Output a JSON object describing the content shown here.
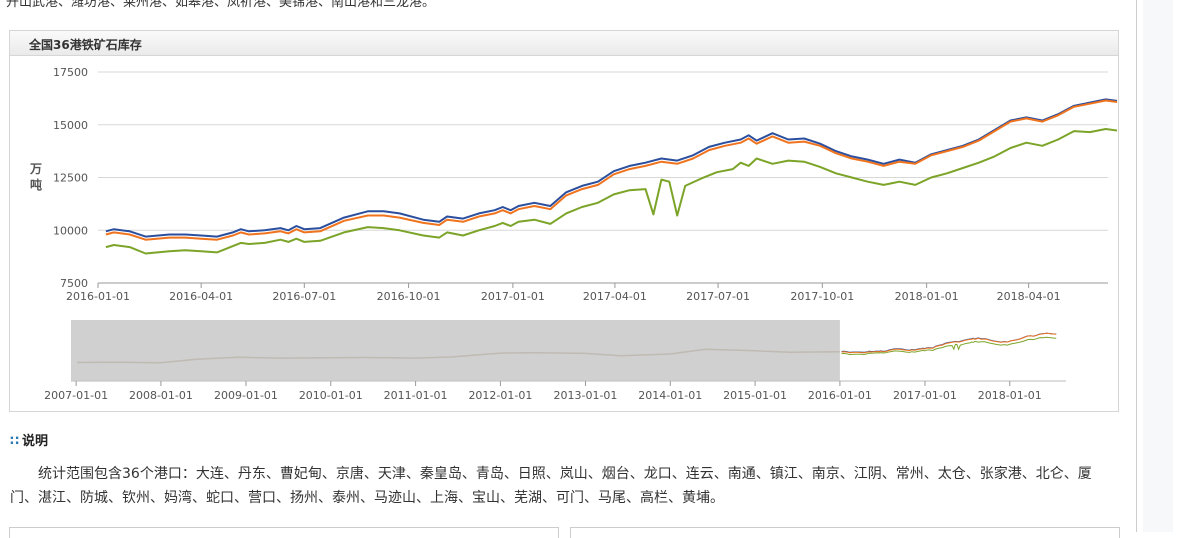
{
  "top_text": "开山武港、潍坊港、莱州港、如皋港、凤祈港、美锦港、南山港和三龙港。",
  "panel": {
    "title": "全国36港铁矿石库存"
  },
  "note": {
    "title": "说明",
    "body": "统计范围包含36个港口：大连、丹东、曹妃甸、京唐、天津、秦皇岛、青岛、日照、岚山、烟台、龙口、连云、南通、镇江、南京、江阴、常州、太仓、张家港、北仑、厦门、湛江、防城、钦州、妈湾、蛇口、营口、扬州、泰州、马迹山、上海、宝山、芜湖、可门、马尾、高栏、黄埔。"
  },
  "colors": {
    "series_blue": "#2b4f9e",
    "series_orange": "#f0731e",
    "series_green": "#7ba428",
    "navigator_mask": "#c8c8c8"
  },
  "chart_data": {
    "type": "line",
    "title": "全国36港铁矿石库存",
    "ylabel": "万吨",
    "ylim": [
      7500,
      17500
    ],
    "yticks": [
      "17500",
      "15000",
      "12500",
      "10000",
      "7500"
    ],
    "xlim": [
      "2016-01-01",
      "2018-06-10"
    ],
    "xticks": [
      "2016-01-01",
      "2016-04-01",
      "2016-07-01",
      "2016-10-01",
      "2017-01-01",
      "2017-04-01",
      "2017-07-01",
      "2017-10-01",
      "2018-01-01",
      "2018-04-01"
    ],
    "grid": true,
    "series": [
      {
        "color": "#2b4f9e",
        "points": [
          [
            "2016-01-08",
            9950
          ],
          [
            "2016-01-15",
            10050
          ],
          [
            "2016-01-29",
            9950
          ],
          [
            "2016-02-12",
            9700
          ],
          [
            "2016-03-04",
            9800
          ],
          [
            "2016-03-18",
            9800
          ],
          [
            "2016-04-01",
            9750
          ],
          [
            "2016-04-15",
            9700
          ],
          [
            "2016-04-29",
            9900
          ],
          [
            "2016-05-06",
            10050
          ],
          [
            "2016-05-13",
            9950
          ],
          [
            "2016-05-27",
            10000
          ],
          [
            "2016-06-10",
            10100
          ],
          [
            "2016-06-17",
            10000
          ],
          [
            "2016-06-24",
            10200
          ],
          [
            "2016-07-01",
            10050
          ],
          [
            "2016-07-15",
            10100
          ],
          [
            "2016-08-05",
            10600
          ],
          [
            "2016-08-26",
            10900
          ],
          [
            "2016-09-09",
            10900
          ],
          [
            "2016-09-23",
            10800
          ],
          [
            "2016-10-14",
            10500
          ],
          [
            "2016-10-28",
            10400
          ],
          [
            "2016-11-04",
            10650
          ],
          [
            "2016-11-18",
            10550
          ],
          [
            "2016-12-02",
            10800
          ],
          [
            "2016-12-16",
            10950
          ],
          [
            "2016-12-23",
            11100
          ],
          [
            "2016-12-30",
            10950
          ],
          [
            "2017-01-06",
            11150
          ],
          [
            "2017-01-20",
            11300
          ],
          [
            "2017-02-03",
            11150
          ],
          [
            "2017-02-17",
            11800
          ],
          [
            "2017-03-03",
            12100
          ],
          [
            "2017-03-17",
            12300
          ],
          [
            "2017-03-31",
            12800
          ],
          [
            "2017-04-14",
            13050
          ],
          [
            "2017-04-28",
            13200
          ],
          [
            "2017-05-12",
            13400
          ],
          [
            "2017-05-26",
            13300
          ],
          [
            "2017-06-09",
            13550
          ],
          [
            "2017-06-23",
            13950
          ],
          [
            "2017-07-07",
            14150
          ],
          [
            "2017-07-21",
            14300
          ],
          [
            "2017-07-28",
            14500
          ],
          [
            "2017-08-04",
            14250
          ],
          [
            "2017-08-18",
            14600
          ],
          [
            "2017-09-01",
            14300
          ],
          [
            "2017-09-15",
            14350
          ],
          [
            "2017-09-29",
            14100
          ],
          [
            "2017-10-13",
            13750
          ],
          [
            "2017-10-27",
            13500
          ],
          [
            "2017-11-10",
            13350
          ],
          [
            "2017-11-24",
            13150
          ],
          [
            "2017-12-08",
            13350
          ],
          [
            "2017-12-22",
            13200
          ],
          [
            "2018-01-05",
            13600
          ],
          [
            "2018-01-19",
            13800
          ],
          [
            "2018-02-02",
            14000
          ],
          [
            "2018-02-16",
            14300
          ],
          [
            "2018-03-02",
            14750
          ],
          [
            "2018-03-16",
            15200
          ],
          [
            "2018-03-30",
            15350
          ],
          [
            "2018-04-13",
            15200
          ],
          [
            "2018-04-27",
            15500
          ],
          [
            "2018-05-11",
            15900
          ],
          [
            "2018-05-25",
            16050
          ],
          [
            "2018-06-08",
            16200
          ],
          [
            "2018-06-22",
            16100
          ],
          [
            "2018-07-06",
            15950
          ],
          [
            "2018-07-20",
            15900
          ]
        ]
      },
      {
        "color": "#f0731e",
        "points": [
          [
            "2016-01-08",
            9800
          ],
          [
            "2016-01-15",
            9900
          ],
          [
            "2016-01-29",
            9800
          ],
          [
            "2016-02-12",
            9550
          ],
          [
            "2016-03-04",
            9650
          ],
          [
            "2016-03-18",
            9650
          ],
          [
            "2016-04-01",
            9600
          ],
          [
            "2016-04-15",
            9550
          ],
          [
            "2016-04-29",
            9750
          ],
          [
            "2016-05-06",
            9900
          ],
          [
            "2016-05-13",
            9800
          ],
          [
            "2016-05-27",
            9850
          ],
          [
            "2016-06-10",
            9950
          ],
          [
            "2016-06-17",
            9850
          ],
          [
            "2016-06-24",
            10050
          ],
          [
            "2016-07-01",
            9900
          ],
          [
            "2016-07-15",
            9950
          ],
          [
            "2016-08-05",
            10450
          ],
          [
            "2016-08-26",
            10700
          ],
          [
            "2016-09-09",
            10700
          ],
          [
            "2016-09-23",
            10600
          ],
          [
            "2016-10-14",
            10350
          ],
          [
            "2016-10-28",
            10250
          ],
          [
            "2016-11-04",
            10500
          ],
          [
            "2016-11-18",
            10400
          ],
          [
            "2016-12-02",
            10650
          ],
          [
            "2016-12-16",
            10800
          ],
          [
            "2016-12-23",
            10950
          ],
          [
            "2016-12-30",
            10800
          ],
          [
            "2017-01-06",
            11000
          ],
          [
            "2017-01-20",
            11150
          ],
          [
            "2017-02-03",
            11000
          ],
          [
            "2017-02-17",
            11650
          ],
          [
            "2017-03-03",
            11950
          ],
          [
            "2017-03-17",
            12150
          ],
          [
            "2017-03-31",
            12650
          ],
          [
            "2017-04-14",
            12900
          ],
          [
            "2017-04-28",
            13050
          ],
          [
            "2017-05-12",
            13250
          ],
          [
            "2017-05-26",
            13150
          ],
          [
            "2017-06-09",
            13400
          ],
          [
            "2017-06-23",
            13800
          ],
          [
            "2017-07-07",
            14000
          ],
          [
            "2017-07-21",
            14150
          ],
          [
            "2017-07-28",
            14350
          ],
          [
            "2017-08-04",
            14100
          ],
          [
            "2017-08-18",
            14450
          ],
          [
            "2017-09-01",
            14150
          ],
          [
            "2017-09-15",
            14200
          ],
          [
            "2017-09-29",
            14000
          ],
          [
            "2017-10-13",
            13650
          ],
          [
            "2017-10-27",
            13400
          ],
          [
            "2017-11-10",
            13250
          ],
          [
            "2017-11-24",
            13050
          ],
          [
            "2017-12-08",
            13250
          ],
          [
            "2017-12-22",
            13150
          ],
          [
            "2018-01-05",
            13550
          ],
          [
            "2018-01-19",
            13750
          ],
          [
            "2018-02-02",
            13950
          ],
          [
            "2018-02-16",
            14250
          ],
          [
            "2018-03-02",
            14700
          ],
          [
            "2018-03-16",
            15150
          ],
          [
            "2018-03-30",
            15300
          ],
          [
            "2018-04-13",
            15150
          ],
          [
            "2018-04-27",
            15450
          ],
          [
            "2018-05-11",
            15850
          ],
          [
            "2018-05-25",
            16000
          ],
          [
            "2018-06-08",
            16150
          ],
          [
            "2018-06-22",
            16050
          ],
          [
            "2018-07-06",
            15900
          ],
          [
            "2018-07-20",
            15850
          ]
        ]
      },
      {
        "color": "#7ba428",
        "points": [
          [
            "2016-01-08",
            9200
          ],
          [
            "2016-01-15",
            9300
          ],
          [
            "2016-01-29",
            9200
          ],
          [
            "2016-02-12",
            8900
          ],
          [
            "2016-03-04",
            9000
          ],
          [
            "2016-03-18",
            9050
          ],
          [
            "2016-04-01",
            9000
          ],
          [
            "2016-04-15",
            8950
          ],
          [
            "2016-04-29",
            9250
          ],
          [
            "2016-05-06",
            9400
          ],
          [
            "2016-05-13",
            9350
          ],
          [
            "2016-05-27",
            9400
          ],
          [
            "2016-06-10",
            9550
          ],
          [
            "2016-06-17",
            9450
          ],
          [
            "2016-06-24",
            9600
          ],
          [
            "2016-07-01",
            9450
          ],
          [
            "2016-07-15",
            9500
          ],
          [
            "2016-08-05",
            9900
          ],
          [
            "2016-08-26",
            10150
          ],
          [
            "2016-09-09",
            10100
          ],
          [
            "2016-09-23",
            10000
          ],
          [
            "2016-10-14",
            9750
          ],
          [
            "2016-10-28",
            9650
          ],
          [
            "2016-11-04",
            9900
          ],
          [
            "2016-11-18",
            9750
          ],
          [
            "2016-12-02",
            10000
          ],
          [
            "2016-12-16",
            10200
          ],
          [
            "2016-12-23",
            10350
          ],
          [
            "2016-12-30",
            10200
          ],
          [
            "2017-01-06",
            10400
          ],
          [
            "2017-01-20",
            10500
          ],
          [
            "2017-02-03",
            10300
          ],
          [
            "2017-02-17",
            10800
          ],
          [
            "2017-03-03",
            11100
          ],
          [
            "2017-03-17",
            11300
          ],
          [
            "2017-03-31",
            11700
          ],
          [
            "2017-04-14",
            11900
          ],
          [
            "2017-04-28",
            11950
          ],
          [
            "2017-05-05",
            10750
          ],
          [
            "2017-05-12",
            12400
          ],
          [
            "2017-05-19",
            12300
          ],
          [
            "2017-05-26",
            10700
          ],
          [
            "2017-06-02",
            12100
          ],
          [
            "2017-06-16",
            12450
          ],
          [
            "2017-06-30",
            12750
          ],
          [
            "2017-07-14",
            12900
          ],
          [
            "2017-07-21",
            13200
          ],
          [
            "2017-07-28",
            13050
          ],
          [
            "2017-08-04",
            13400
          ],
          [
            "2017-08-18",
            13150
          ],
          [
            "2017-09-01",
            13300
          ],
          [
            "2017-09-15",
            13250
          ],
          [
            "2017-09-29",
            13000
          ],
          [
            "2017-10-13",
            12700
          ],
          [
            "2017-10-27",
            12500
          ],
          [
            "2017-11-10",
            12300
          ],
          [
            "2017-11-24",
            12150
          ],
          [
            "2017-12-08",
            12300
          ],
          [
            "2017-12-22",
            12150
          ],
          [
            "2018-01-05",
            12500
          ],
          [
            "2018-01-19",
            12700
          ],
          [
            "2018-02-02",
            12950
          ],
          [
            "2018-02-16",
            13200
          ],
          [
            "2018-03-02",
            13500
          ],
          [
            "2018-03-16",
            13900
          ],
          [
            "2018-03-30",
            14150
          ],
          [
            "2018-04-13",
            14000
          ],
          [
            "2018-04-27",
            14300
          ],
          [
            "2018-05-11",
            14700
          ],
          [
            "2018-05-25",
            14650
          ],
          [
            "2018-06-08",
            14800
          ],
          [
            "2018-06-22",
            14700
          ],
          [
            "2018-07-06",
            14550
          ],
          [
            "2018-07-20",
            14450
          ]
        ]
      }
    ],
    "navigator": {
      "xticks": [
        "2007-01-01",
        "2008-01-01",
        "2009-01-01",
        "2010-01-01",
        "2011-01-01",
        "2012-01-01",
        "2013-01-01",
        "2014-01-01",
        "2015-01-01",
        "2016-01-01",
        "2017-01-01",
        "2018-01-01"
      ],
      "xlim": [
        "2006-12-10",
        "2018-08-31"
      ],
      "masked_range": [
        "2006-12-10",
        "2016-01-01"
      ]
    }
  }
}
